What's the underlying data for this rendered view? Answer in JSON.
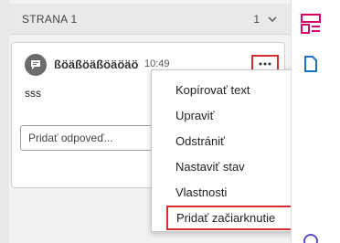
{
  "page_header": {
    "label": "STRANA 1",
    "count": "1"
  },
  "comment": {
    "author": "ßöäßöäßöäöäö",
    "time": "10:49",
    "text": "sss",
    "reply_placeholder": "Pridať odpoveď..."
  },
  "context_menu": {
    "items": [
      {
        "label": "Kopírovať text"
      },
      {
        "label": "Upraviť"
      },
      {
        "label": "Odstrániť"
      },
      {
        "label": "Nastaviť stav",
        "has_submenu": true
      },
      {
        "label": "Vlastnosti"
      },
      {
        "label": "Pridať začiarknutie"
      }
    ]
  },
  "colors": {
    "accent": "#d6006e",
    "highlight_red": "#d32f2f"
  },
  "icons": [
    "comment-icon",
    "more-options-icon",
    "chevron-down-icon",
    "submenu-arrow-icon",
    "layout-panel-icon",
    "document-icon"
  ]
}
